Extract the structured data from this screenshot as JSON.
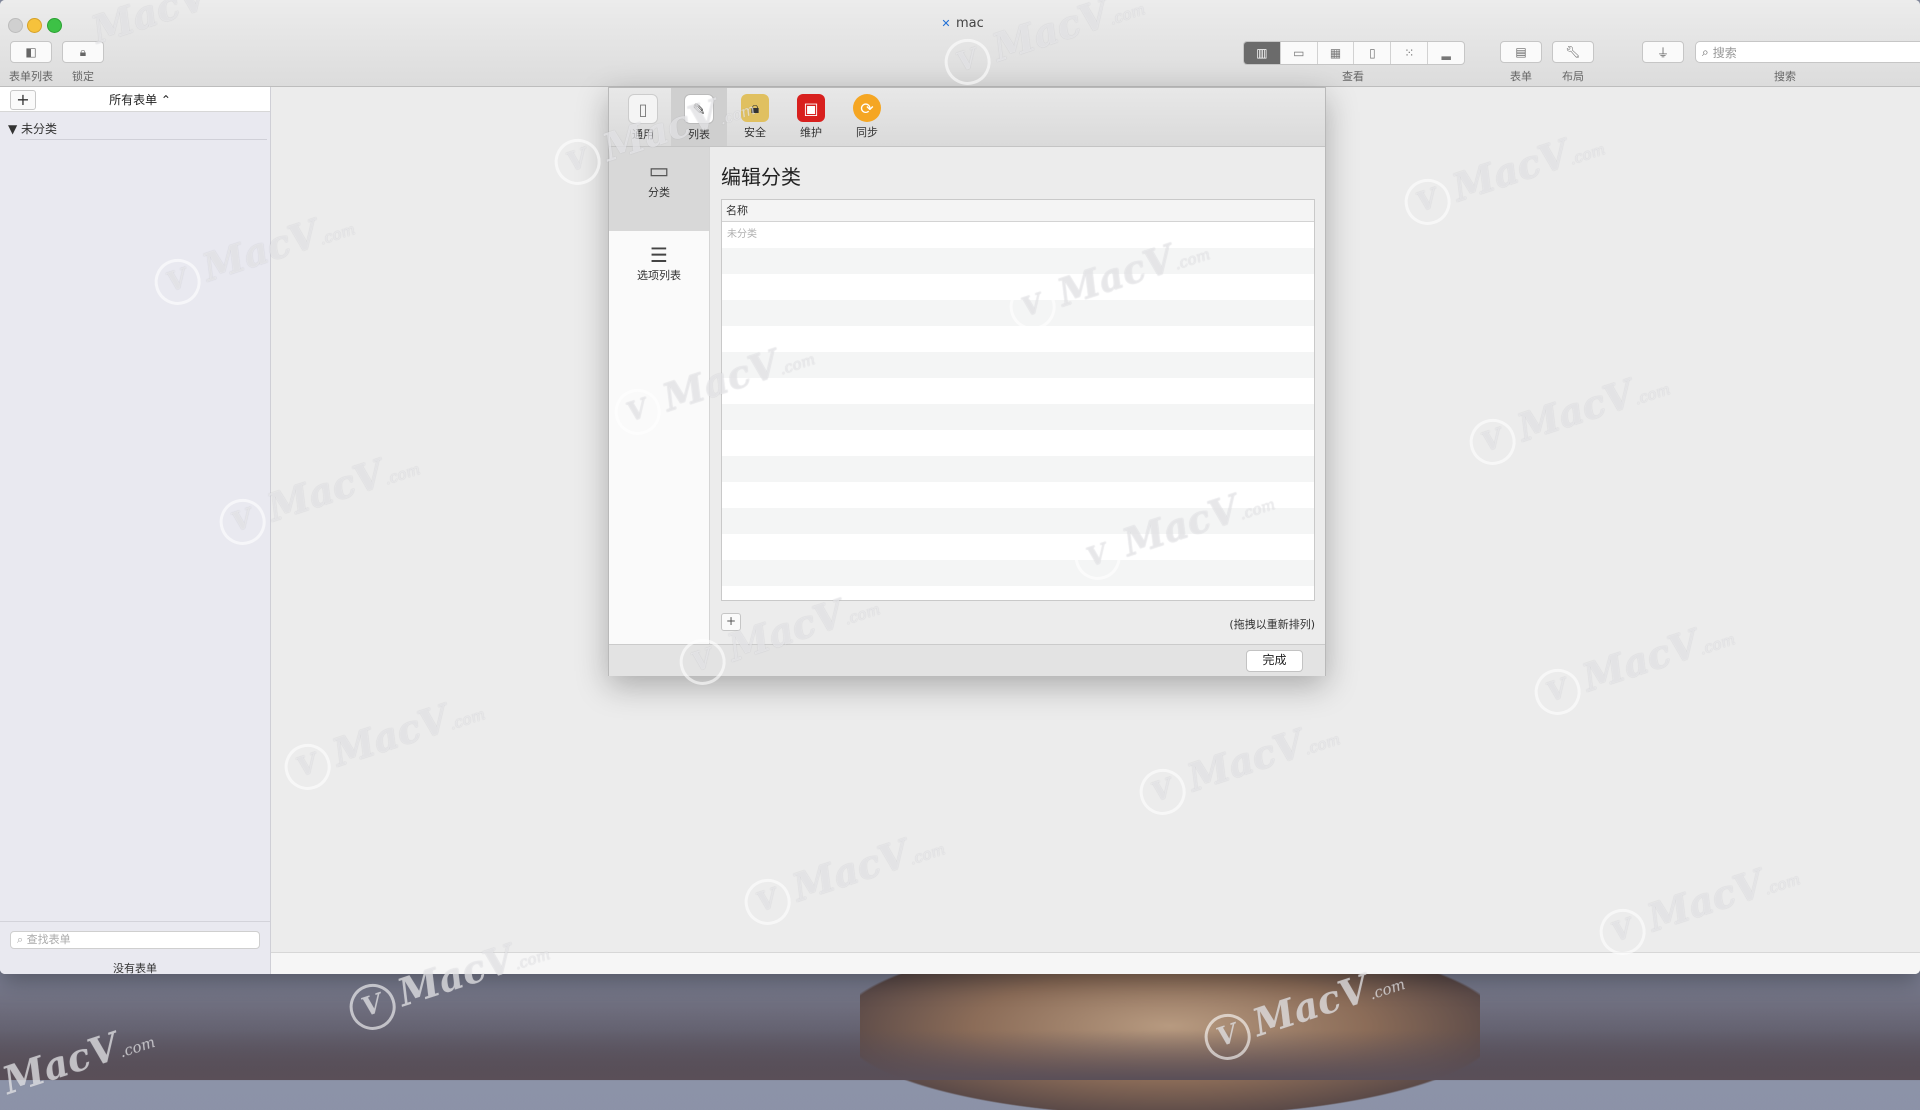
{
  "window": {
    "doc_title": "mac",
    "doc_icon": "x-doc-icon"
  },
  "toolbar": {
    "form_list_label": "表单列表",
    "lock_label": "锁定",
    "view_label": "查看",
    "form_label": "表单",
    "layout_label": "布局",
    "search_label": "搜索",
    "search_placeholder": "搜索"
  },
  "sidebar": {
    "add": "+",
    "popup": "所有表单 ⌃",
    "group": "▼ 未分类",
    "find_placeholder": "查找表单",
    "no_forms": "没有表单"
  },
  "sheet": {
    "tabs": [
      {
        "label": "通用",
        "icon": "phone-icon"
      },
      {
        "label": "列表",
        "icon": "checklist-icon"
      },
      {
        "label": "安全",
        "icon": "lock-icon"
      },
      {
        "label": "维护",
        "icon": "toolbox-icon"
      },
      {
        "label": "同步",
        "icon": "sync-icon"
      }
    ],
    "categories": [
      {
        "label": "分类",
        "icon": "tray-icon"
      },
      {
        "label": "选项列表",
        "icon": "list-icon"
      }
    ],
    "title": "编辑分类",
    "column_header": "名称",
    "rows": [
      "未分类"
    ],
    "add_button": "+",
    "hint": "(拖拽以重新排列)",
    "done": "完成"
  },
  "watermark": {
    "brand": "MacV",
    "suffix": ".com"
  },
  "colors": {
    "accent": "#3dc146",
    "min": "#f6c23c"
  }
}
